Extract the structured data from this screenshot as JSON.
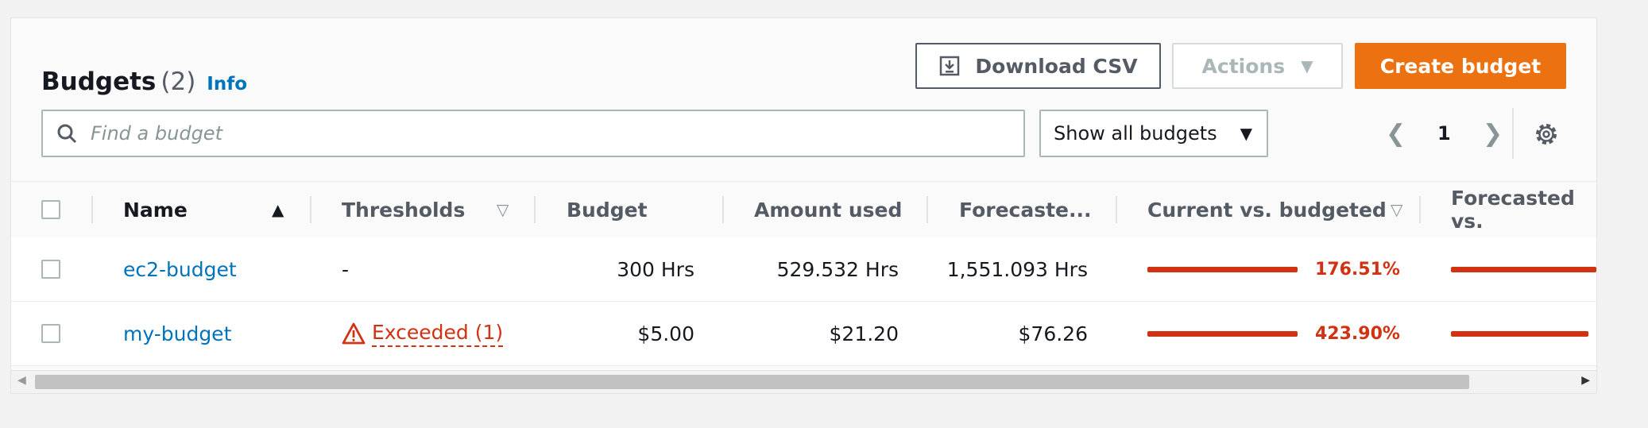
{
  "header": {
    "title": "Budgets",
    "count": "(2)",
    "info": "Info"
  },
  "toolbar": {
    "download_label": "Download CSV",
    "actions_label": "Actions",
    "create_label": "Create budget"
  },
  "filter": {
    "search_placeholder": "Find a budget",
    "select_value": "Show all budgets"
  },
  "pagination": {
    "current_page": "1"
  },
  "table": {
    "columns": [
      "Name",
      "Thresholds",
      "Budget",
      "Amount used",
      "Forecaste...",
      "Current vs. budgeted",
      "Forecasted vs."
    ],
    "rows": [
      {
        "name": "ec2-budget",
        "threshold": "-",
        "budget": "300 Hrs",
        "used": "529.532 Hrs",
        "forecast": "1,551.093 Hrs",
        "current_pct": "176.51%"
      },
      {
        "name": "my-budget",
        "threshold": "Exceeded (1)",
        "budget": "$5.00",
        "used": "$21.20",
        "forecast": "$76.26",
        "current_pct": "423.90%"
      }
    ]
  },
  "colors": {
    "accent": "#ec7211",
    "link": "#0073bb",
    "error": "#d13212"
  },
  "icons": [
    "download-icon",
    "caret-down-icon",
    "search-icon",
    "chevron-left-icon",
    "chevron-right-icon",
    "settings-gear-icon",
    "sort-ascending-icon",
    "filter-caret-icon",
    "warning-icon"
  ]
}
